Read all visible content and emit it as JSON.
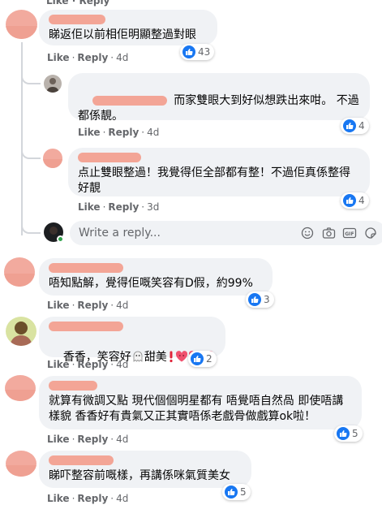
{
  "top_fragment": "Like · Reply",
  "actions": {
    "like": "Like",
    "reply": "Reply",
    "separator": "·"
  },
  "reply_box": {
    "placeholder": "Write a reply..."
  },
  "comments": [
    {
      "text": "睇返佢以前相佢明顯整過對眼",
      "age": "4d",
      "likes": "43"
    },
    {
      "text": " 而家雙眼大到好似想跌出來咁。 不過都係靚。",
      "age": "4d",
      "likes": "4"
    },
    {
      "text": "点止雙眼整過！我覺得佢全部都有整！不過佢真係整得好靚",
      "age": "3d",
      "likes": "4"
    },
    {
      "text": "唔知點解，覺得佢嘅笑容有D假，約99%",
      "age": "4d",
      "likes": "3"
    },
    {
      "text_a": "香香，笑容好",
      "text_b": "甜美",
      "age": "4d",
      "likes": "2"
    },
    {
      "text": "就算有微調又點 現代個個明星都有 唔覺唔自然咼 即使唔講樣貌 香香好有貴氣又正其實唔係老戲骨做戲算ok啦！",
      "age": "4d",
      "likes": "5"
    },
    {
      "text": "睇吓整容前嘅樣，再講係咪氣質美女",
      "age": "4d",
      "likes": "5"
    }
  ]
}
